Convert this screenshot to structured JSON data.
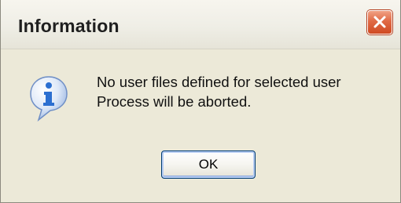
{
  "dialog": {
    "title": "Information",
    "close_icon": "close-icon",
    "message_icon": "information-icon",
    "message_lines": [
      "No user files defined for selected user",
      "Process will be aborted."
    ],
    "ok_label": "OK"
  },
  "colors": {
    "dialog_background": "#ece9d8",
    "close_button": "#e06a45",
    "ok_border": "#003c74",
    "icon_blue": "#2c6fd0"
  }
}
